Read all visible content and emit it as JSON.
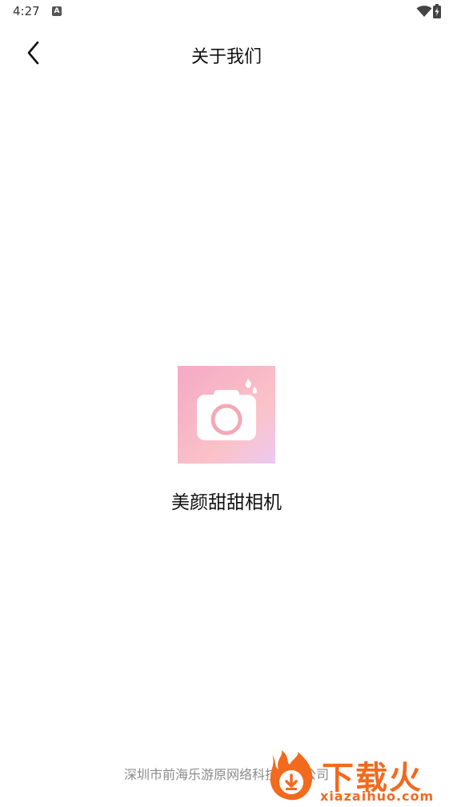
{
  "status_bar": {
    "time": "4:27",
    "notification_glyph": "A",
    "icons": [
      "wifi-icon",
      "battery-icon"
    ]
  },
  "header": {
    "back_icon": "chevron-left-icon",
    "title": "关于我们"
  },
  "app": {
    "logo_icon": "camera-icon",
    "name": "美颜甜甜相机"
  },
  "footer": {
    "company": "深圳市前海乐游原网络科技有限公司"
  },
  "watermark": {
    "brand": "下载火",
    "url": "xiazaihuo.com"
  },
  "colors": {
    "logo_gradient": [
      "#f6a9c6",
      "#ecc9f2"
    ],
    "watermark": "#f26a1e",
    "footer_text": "#8a8a8a"
  }
}
